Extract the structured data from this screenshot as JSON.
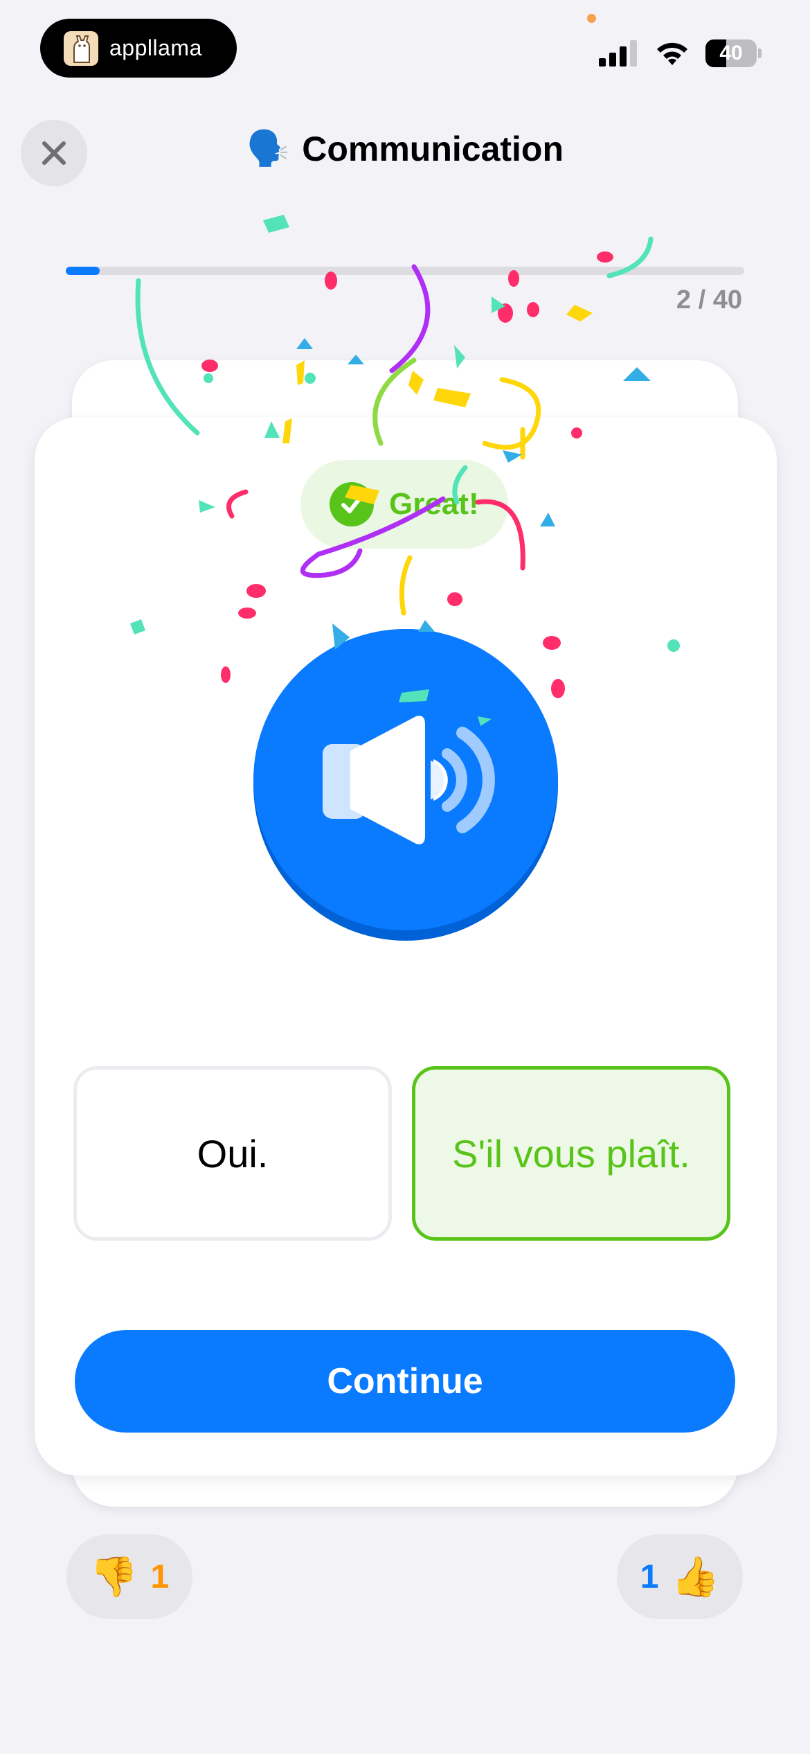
{
  "status_bar": {
    "app_name": "appllama",
    "battery_level": "40"
  },
  "header": {
    "title_emoji": "🗣️",
    "title": "Communication"
  },
  "progress": {
    "current": 2,
    "total": 40,
    "label": "2 / 40"
  },
  "card": {
    "feedback": "Great!",
    "options": [
      {
        "label": "Oui.",
        "state": "default"
      },
      {
        "label": "S'il vous plaît.",
        "state": "correct"
      }
    ],
    "continue_label": "Continue"
  },
  "votes": {
    "down_count": "1",
    "up_count": "1",
    "down_icon": "👎",
    "up_icon": "👍"
  },
  "colors": {
    "accent": "#0a7bff",
    "correct": "#58c41a",
    "correct_bg": "#eef8e6",
    "background": "#f2f2f7",
    "downvote": "#ff9500"
  }
}
